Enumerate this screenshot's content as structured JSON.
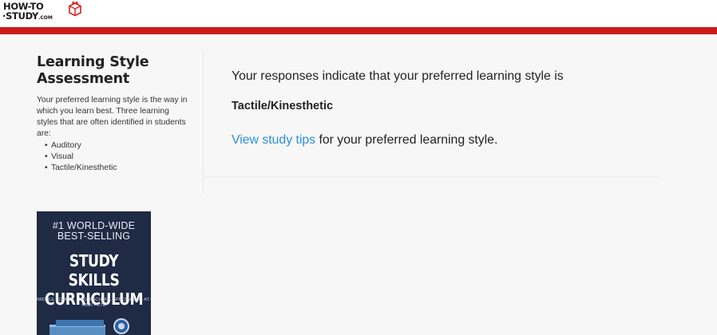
{
  "header": {
    "logo_line1": "HOW-TO",
    "logo_line2": "STUDY",
    "logo_suffix": ".COM",
    "brand_color": "#cc1b1b"
  },
  "sidebar": {
    "title": "Learning Style Assessment",
    "description": "Your preferred learning style is the way in which you learn best. Three learning styles that are often identified in students are:",
    "styles": [
      "Auditory",
      "Visual",
      "Tactile/Kinesthetic"
    ]
  },
  "book": {
    "top": "#1 WORLD-WIDE BEST-SELLING",
    "headline": "STUDY SKILLS CURRICULUM",
    "subline": "MIDDLE SCHOOL • HIGH SCHOOL SPECIAL ED • AT-RISK • CTE"
  },
  "main": {
    "intro": "Your responses indicate that your preferred learning style is",
    "result": "Tactile/Kinesthetic",
    "tips_link": "View study tips",
    "tips_rest": " for your preferred learning style.",
    "link_color": "#2d8fd5"
  }
}
